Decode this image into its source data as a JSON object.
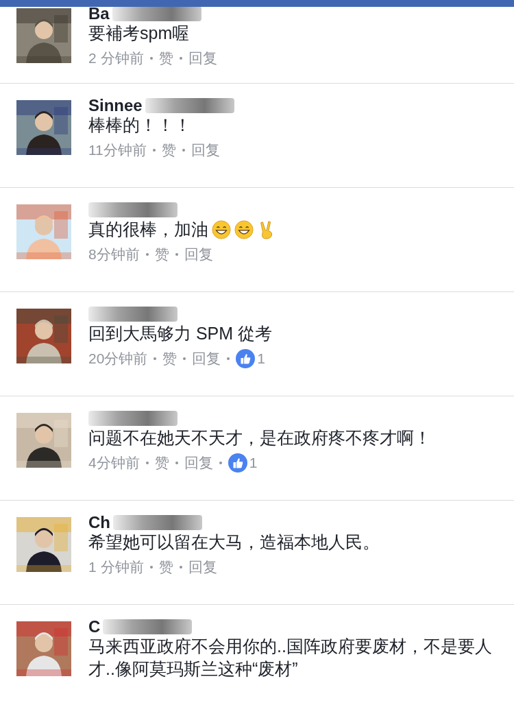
{
  "comments": [
    {
      "name": "Ba",
      "text": "要補考spm喔",
      "time": "2 分钟前",
      "like_label": "赞",
      "reply_label": "回复"
    },
    {
      "name": "Sinnee",
      "text": "棒棒的！！！",
      "time": "11分钟前",
      "like_label": "赞",
      "reply_label": "回复"
    },
    {
      "text": "真的很棒，加油",
      "emoji": [
        {
          "kind": "grin"
        },
        {
          "kind": "grin"
        },
        {
          "kind": "victory"
        }
      ],
      "time": "8分钟前",
      "like_label": "赞",
      "reply_label": "回复"
    },
    {
      "text": "回到大馬够力 SPM 從考",
      "time": "20分钟前",
      "like_label": "赞",
      "reply_label": "回复",
      "likes": "1"
    },
    {
      "text": "问题不在她天不天才，是在政府疼不疼才啊！",
      "time": "4分钟前",
      "like_label": "赞",
      "reply_label": "回复",
      "likes": "1"
    },
    {
      "name": "Ch",
      "text": "希望她可以留在大马，造福本地人民。",
      "time": "1 分钟前",
      "like_label": "赞",
      "reply_label": "回复"
    },
    {
      "name": "C",
      "text": "马来西亚政府不会用你的..国阵政府要废材，不是要人才..像阿莫玛斯兰这种“废材”"
    }
  ]
}
